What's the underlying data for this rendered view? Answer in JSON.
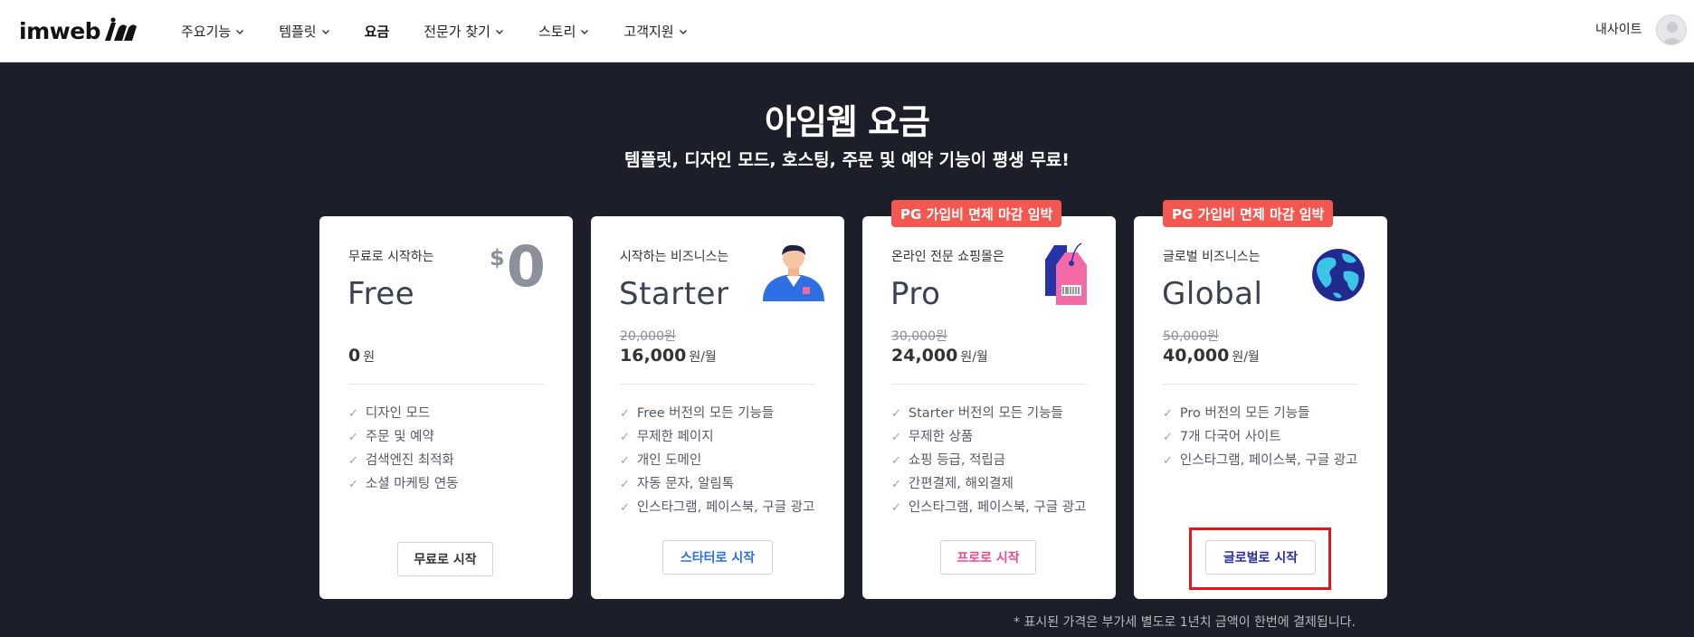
{
  "nav": {
    "logo": "imweb",
    "items": [
      {
        "label": "주요기능",
        "has_dropdown": true
      },
      {
        "label": "템플릿",
        "has_dropdown": true
      },
      {
        "label": "요금",
        "has_dropdown": false,
        "active": true
      },
      {
        "label": "전문가 찾기",
        "has_dropdown": true
      },
      {
        "label": "스토리",
        "has_dropdown": true
      },
      {
        "label": "고객지원",
        "has_dropdown": true
      }
    ],
    "mysite": "내사이트"
  },
  "hero": {
    "title": "아임웹 요금",
    "subtitle": "템플릿, 디자인 모드, 호스팅, 주문 및 예약 기능이 평생 무료!"
  },
  "plans": [
    {
      "tagline": "무료로 시작하는",
      "name": "Free",
      "big_symbol": "$",
      "big_value": "0",
      "price": "0",
      "price_unit": "원",
      "features": [
        "디자인 모드",
        "주문 및 예약",
        "검색엔진 최적화",
        "소셜 마케팅 연동"
      ],
      "button": "무료로 시작",
      "button_color": "#333333"
    },
    {
      "tagline": "시작하는 비즈니스는",
      "name": "Starter",
      "old_price": "20,000원",
      "price": "16,000",
      "price_unit": "원/월",
      "features": [
        "Free 버전의 모든 기능들",
        "무제한 페이지",
        "개인 도메인",
        "자동 문자, 알림톡",
        "인스타그램, 페이스북, 구글 광고"
      ],
      "button": "스타터로 시작",
      "button_color": "#2b6fe0"
    },
    {
      "tagline": "온라인 전문 쇼핑몰은",
      "name": "Pro",
      "badge": "PG 가입비 면제 마감 임박",
      "old_price": "30,000원",
      "price": "24,000",
      "price_unit": "원/월",
      "features": [
        "Starter 버전의 모든 기능들",
        "무제한 상품",
        "쇼핑 등급, 적립금",
        "간편결제, 해외결제",
        "인스타그램, 페이스북, 구글 광고"
      ],
      "button": "프로로 시작",
      "button_color": "#ee4a8c"
    },
    {
      "tagline": "글로벌 비즈니스는",
      "name": "Global",
      "badge": "PG 가입비 면제 마감 임박",
      "old_price": "50,000원",
      "price": "40,000",
      "price_unit": "원/월",
      "features": [
        "Pro 버전의 모든 기능들",
        "7개 다국어 사이트",
        "인스타그램, 페이스북, 구글 광고"
      ],
      "button": "글로벌로 시작",
      "button_color": "#2a2f9e"
    }
  ],
  "footnote": "* 표시된 가격은 부가세 별도로 1년치 금액이 한번에 결제됩니다.",
  "colors": {
    "background": "#1c1f29",
    "badge": "#f25750",
    "highlight_box": "#e3161b"
  }
}
